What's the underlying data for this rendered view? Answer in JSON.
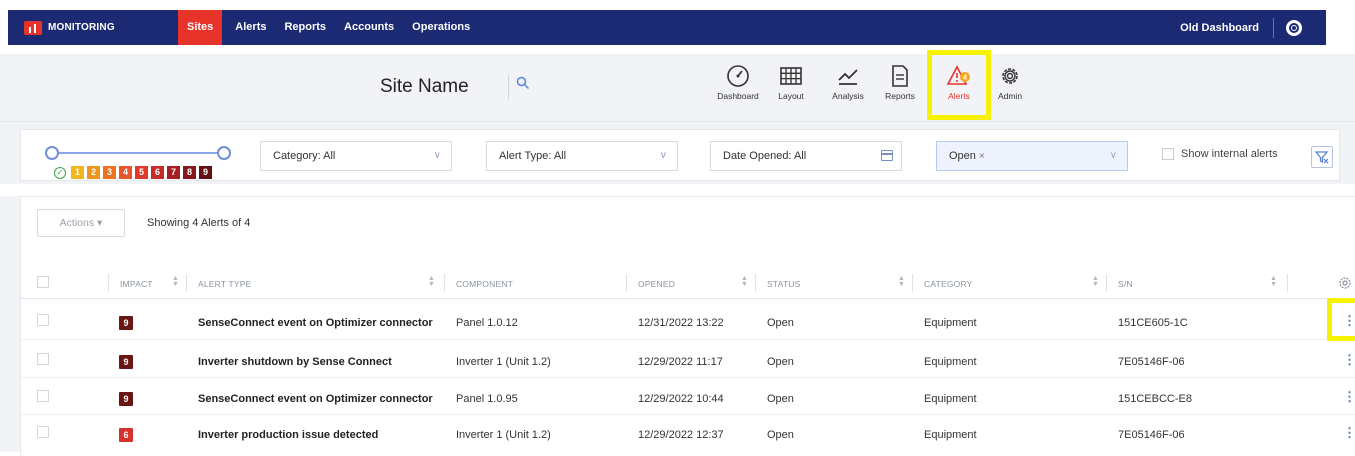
{
  "nav": {
    "brand": "MONITORING",
    "items": [
      "Sites",
      "Alerts",
      "Reports",
      "Accounts",
      "Operations"
    ],
    "active": "Sites",
    "old_dashboard": "Old Dashboard"
  },
  "site": {
    "name": "Site Name",
    "toolbar": [
      {
        "label": "Dashboard",
        "icon": "gauge-icon"
      },
      {
        "label": "Layout",
        "icon": "grid-icon"
      },
      {
        "label": "Analysis",
        "icon": "chart-line-icon"
      },
      {
        "label": "Reports",
        "icon": "document-icon"
      },
      {
        "label": "Alerts",
        "icon": "alert-triangle-icon",
        "active": true,
        "badge_color": "#f5a623"
      },
      {
        "label": "Admin",
        "icon": "gear-icon"
      }
    ]
  },
  "filters": {
    "impact_levels": [
      "1",
      "2",
      "3",
      "4",
      "5",
      "6",
      "7",
      "8",
      "9"
    ],
    "impact_colors": [
      "#f0b61c",
      "#f0951c",
      "#ee7320",
      "#e95428",
      "#e23a2a",
      "#c92a2a",
      "#a51f22",
      "#86191c",
      "#5f1113"
    ],
    "category": "Category: All",
    "alert_type": "Alert Type: All",
    "date_opened": "Date Opened: All",
    "status_chip": "Open",
    "status_chip_remove": "×",
    "show_internal": "Show internal alerts",
    "dropdown_chevron": "∨"
  },
  "table": {
    "actions_label": "Actions",
    "showing": "Showing 4 Alerts of 4",
    "columns": [
      "IMPACT",
      "ALERT TYPE",
      "COMPONENT",
      "OPENED",
      "STATUS",
      "CATEGORY",
      "S/N"
    ],
    "rows": [
      {
        "impact": "9",
        "impact_color": "#6a1414",
        "alert_type": "SenseConnect event on Optimizer connector",
        "component": "Panel 1.0.12",
        "opened": "12/31/2022 13:22",
        "status": "Open",
        "category": "Equipment",
        "sn": "151CE605-1C"
      },
      {
        "impact": "9",
        "impact_color": "#6a1414",
        "alert_type": "Inverter shutdown by Sense Connect",
        "component": "Inverter 1 (Unit 1.2)",
        "opened": "12/29/2022 11:17",
        "status": "Open",
        "category": "Equipment",
        "sn": "7E05146F-06"
      },
      {
        "impact": "9",
        "impact_color": "#6a1414",
        "alert_type": "SenseConnect event on Optimizer connector",
        "component": "Panel 1.0.95",
        "opened": "12/29/2022 10:44",
        "status": "Open",
        "category": "Equipment",
        "sn": "151CEBCC-E8"
      },
      {
        "impact": "6",
        "impact_color": "#d7312c",
        "alert_type": "Inverter production issue detected",
        "component": "Inverter 1 (Unit 1.2)",
        "opened": "12/29/2022 12:37",
        "status": "Open",
        "category": "Equipment",
        "sn": "7E05146F-06"
      }
    ],
    "row_menu": "⋮"
  }
}
